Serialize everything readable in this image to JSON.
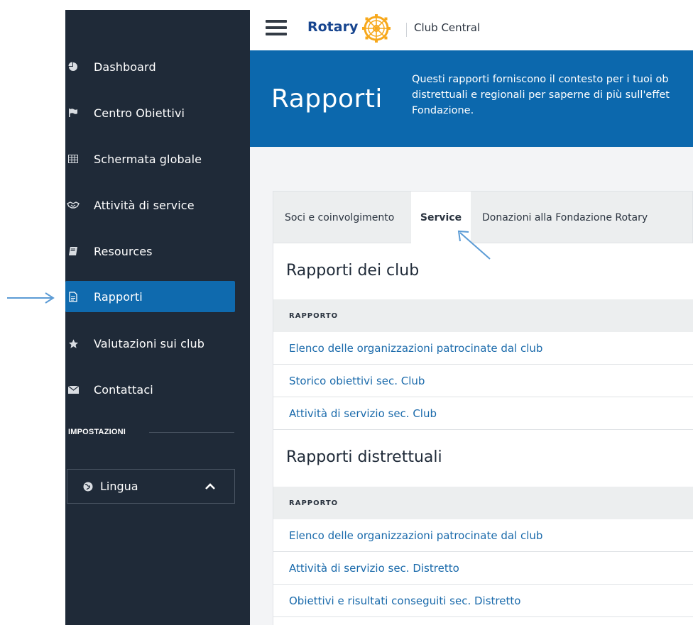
{
  "header": {
    "brand": "Rotary",
    "product": "Club Central"
  },
  "sidebar": {
    "items": [
      {
        "label": "Dashboard",
        "icon": "pie-chart-icon"
      },
      {
        "label": "Centro Obiettivi",
        "icon": "flag-icon"
      },
      {
        "label": "Schermata globale",
        "icon": "table-icon"
      },
      {
        "label": "Attività di service",
        "icon": "handshake-icon"
      },
      {
        "label": "Resources",
        "icon": "book-icon"
      },
      {
        "label": "Rapporti",
        "icon": "document-icon",
        "active": true
      },
      {
        "label": "Valutazioni sui club",
        "icon": "star-icon"
      },
      {
        "label": "Contattaci",
        "icon": "envelope-icon"
      }
    ],
    "settings_label": "IMPOSTAZIONI",
    "language_label": "Lingua"
  },
  "banner": {
    "title": "Rapporti",
    "line1": "Questi rapporti forniscono il contesto per i tuoi ob",
    "line2": "distrettuali e regionali per saperne di più sull'effet",
    "line3": "Fondazione."
  },
  "tabs": [
    {
      "label": "Soci e coinvolgimento"
    },
    {
      "label": "Service",
      "active": true
    },
    {
      "label": "Donazioni alla Fondazione Rotary"
    }
  ],
  "sections": {
    "club": {
      "title": "Rapporti dei club",
      "column": "RAPPORTO",
      "rows": [
        "Elenco delle organizzazioni patrocinate dal club",
        "Storico obiettivi sec. Club",
        "Attività di servizio sec. Club"
      ]
    },
    "district": {
      "title": "Rapporti distrettuali",
      "column": "RAPPORTO",
      "rows": [
        "Elenco delle organizzazioni patrocinate dal club",
        "Attività di servizio sec. Distretto",
        "Obiettivi e risultati conseguiti sec. Distretto"
      ]
    }
  },
  "colors": {
    "sidebar_bg": "#1f2a38",
    "active_item": "#0f6aae",
    "banner_bg": "#0c68ad",
    "link": "#1a6aab",
    "annotation_arrow": "#5b9bd5",
    "rotary_gold": "#f7a81b",
    "rotary_blue": "#17458f"
  }
}
